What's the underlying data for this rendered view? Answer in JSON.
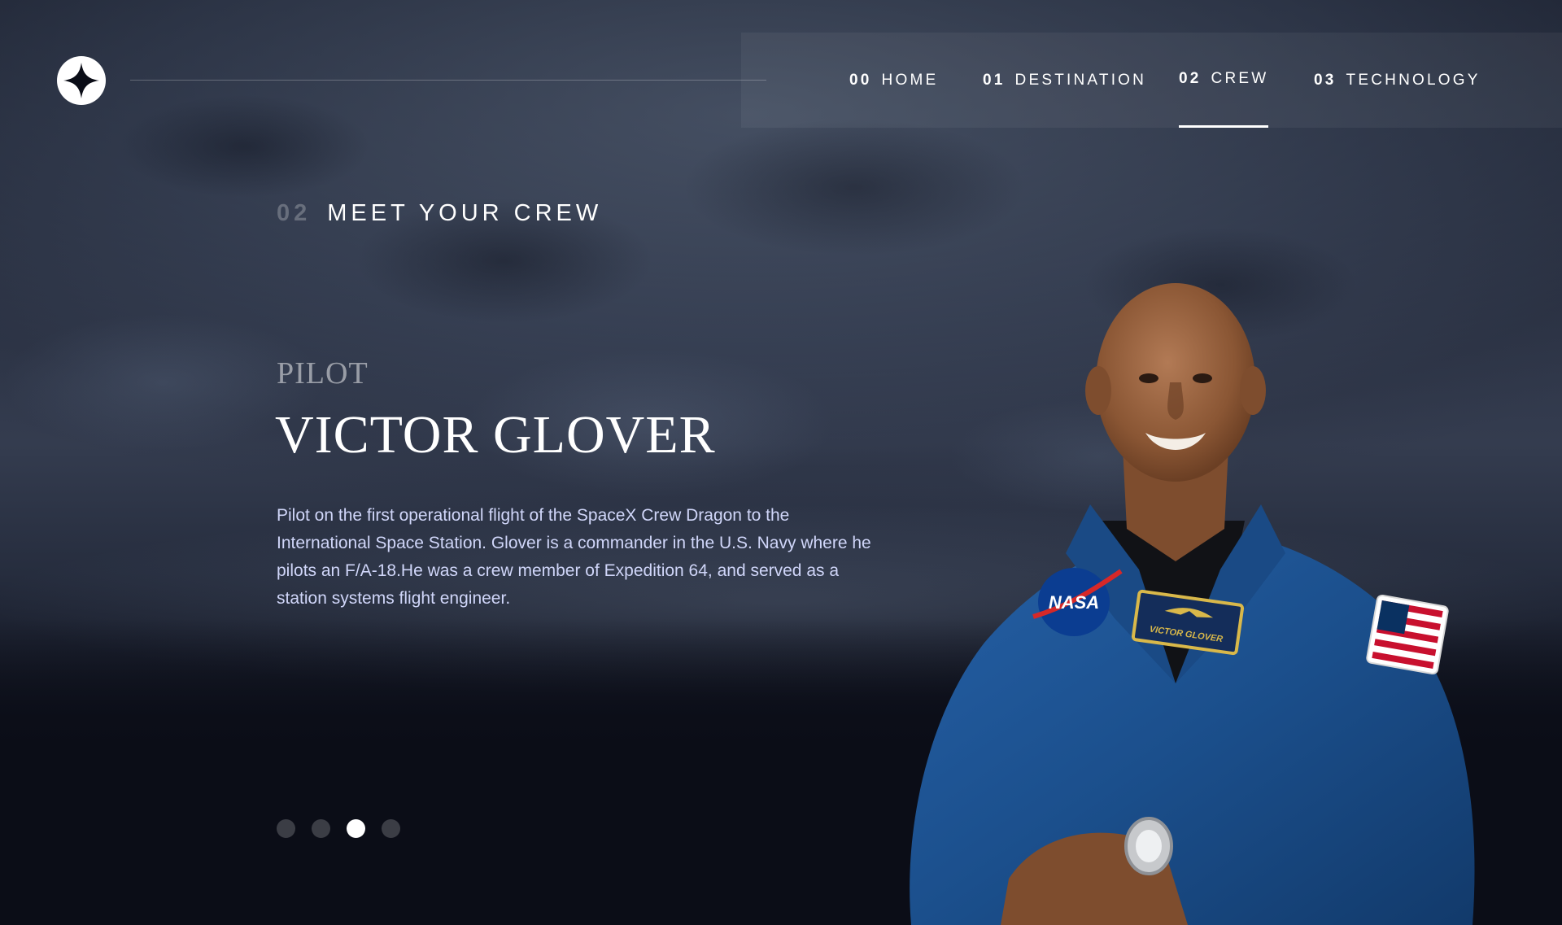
{
  "nav": {
    "items": [
      {
        "num": "00",
        "label": "HOME",
        "active": false
      },
      {
        "num": "01",
        "label": "DESTINATION",
        "active": false
      },
      {
        "num": "02",
        "label": "CREW",
        "active": true
      },
      {
        "num": "03",
        "label": "TECHNOLOGY",
        "active": false
      }
    ]
  },
  "page": {
    "eyebrow_num": "02",
    "eyebrow_label": "MEET YOUR CREW"
  },
  "crew": {
    "role": "PILOT",
    "name": "VICTOR GLOVER",
    "bio": "Pilot on the first operational flight of the SpaceX Crew Dragon to the International Space Station. Glover is a commander in the U.S. Navy where he pilots an F/A-18.He was a crew member of Expedition 64, and served as a station systems flight engineer.",
    "photo_patch_text": "VICTOR GLOVER",
    "photo_nasa_text": "NASA"
  },
  "carousel": {
    "count": 4,
    "active_index": 2
  },
  "colors": {
    "background": "#0b0d17",
    "text": "#ffffff",
    "body_text": "#d0d6f9",
    "suit_blue": "#1b4f8c"
  },
  "icons": {
    "logo": "star-logo-icon"
  }
}
